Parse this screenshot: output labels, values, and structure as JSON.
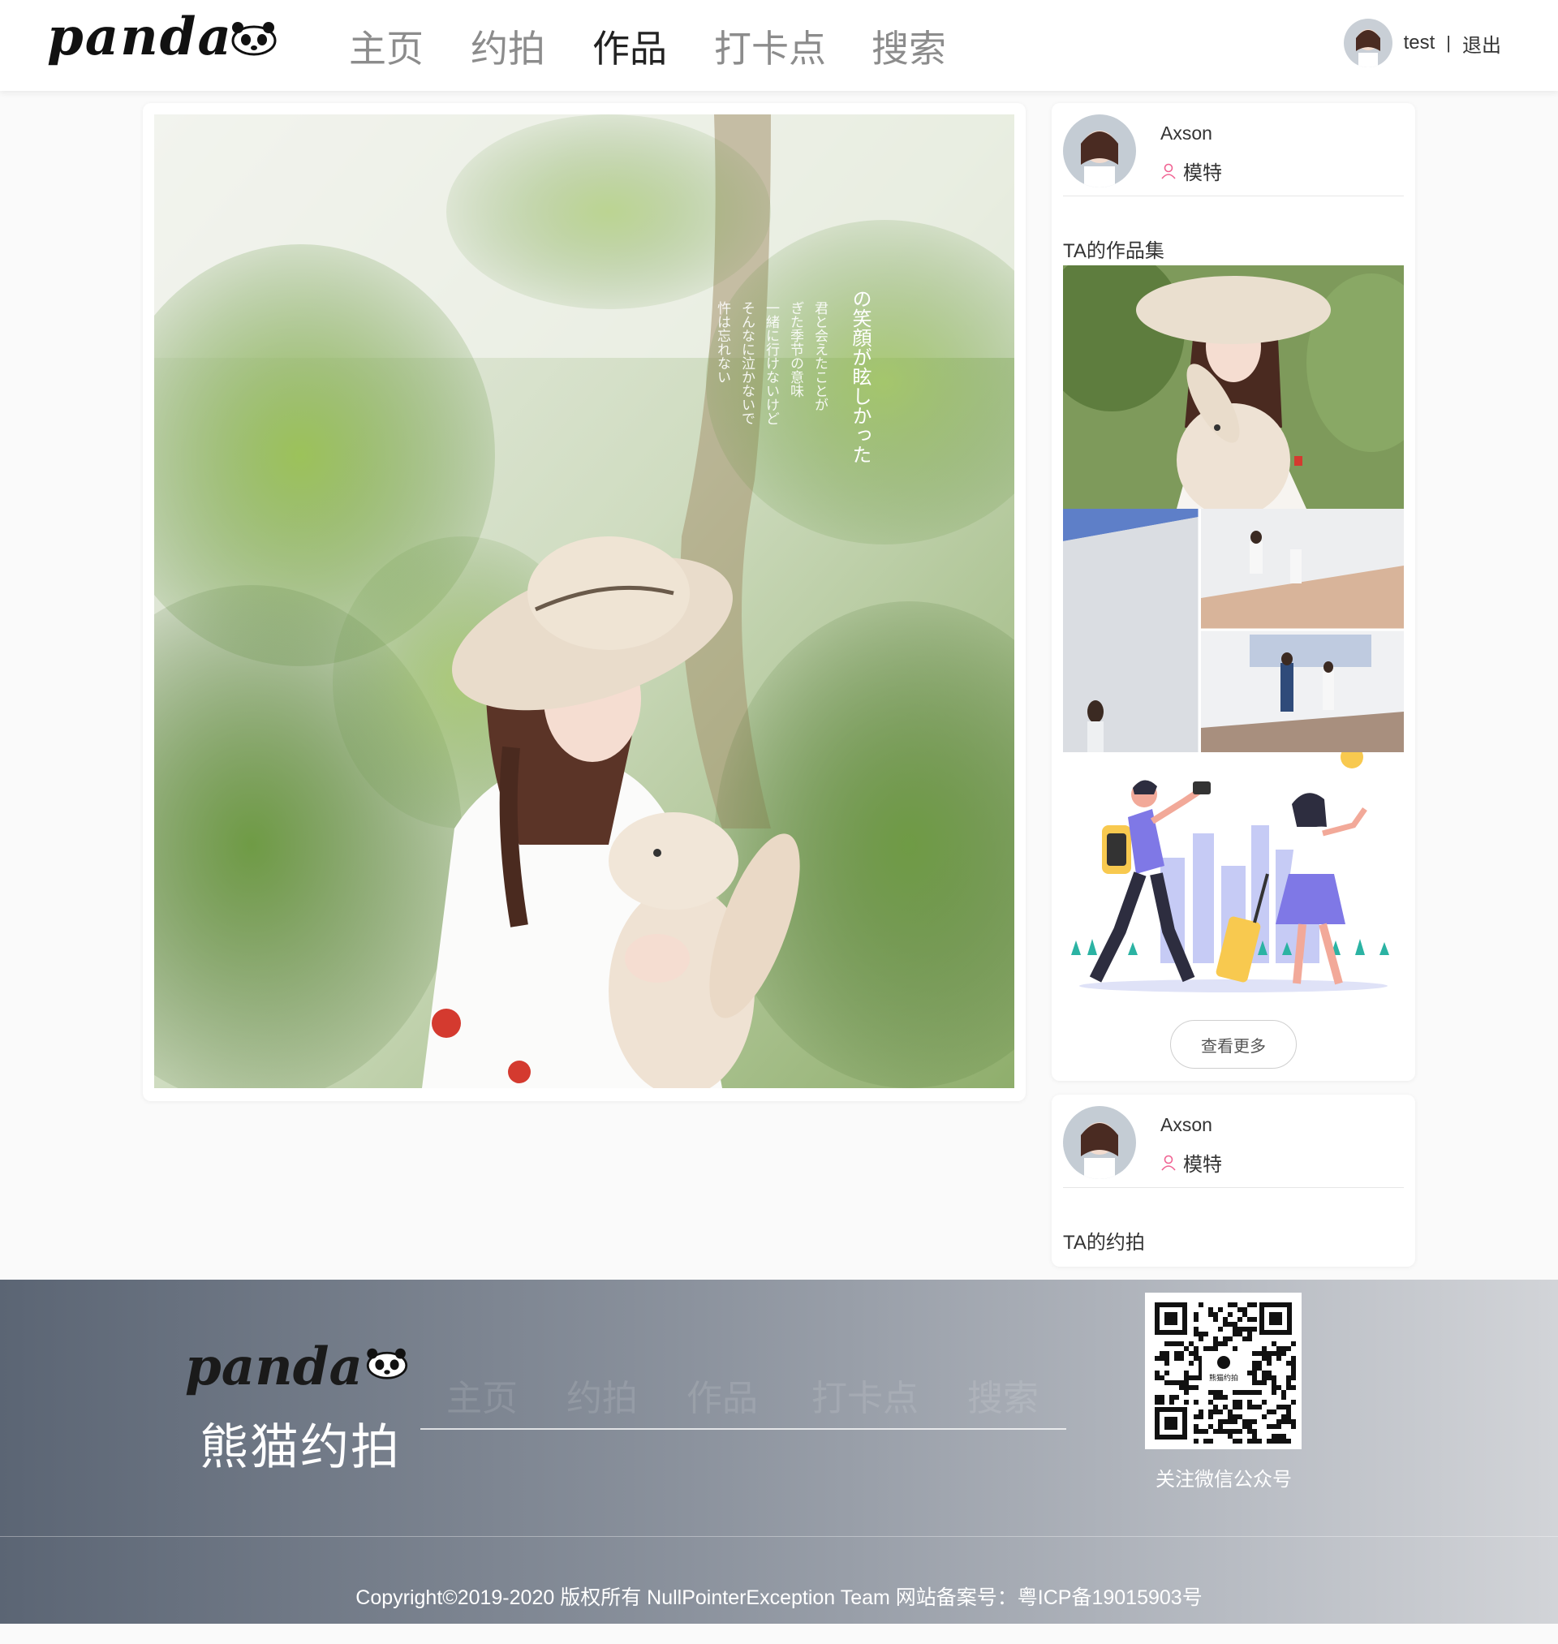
{
  "header": {
    "logo_text": "panda",
    "nav": [
      {
        "label": "主页",
        "active": false
      },
      {
        "label": "约拍",
        "active": false
      },
      {
        "label": "作品",
        "active": true
      },
      {
        "label": "打卡点",
        "active": false
      },
      {
        "label": "搜索",
        "active": false
      }
    ],
    "user": {
      "name": "test",
      "separator": "|",
      "logout": "退出"
    }
  },
  "main": {
    "photo_caption_lines": [
      "君と会えたことが",
      "ぎた季节の意味",
      "一緒に行けないけど",
      "そんなに泣かないで",
      "忤は忘れない"
    ],
    "photo_title": "の笑顔が眩しかった"
  },
  "sidebar": {
    "card1": {
      "author_name": "Axson",
      "author_role": "模特",
      "section_title": "TA的作品集",
      "more_button": "查看更多"
    },
    "card2": {
      "author_name": "Axson",
      "author_role": "模特",
      "section_title": "TA的约拍"
    }
  },
  "footer": {
    "logo_text": "panda",
    "brand": "熊猫约拍",
    "nav": [
      "主页",
      "约拍",
      "作品",
      "打卡点",
      "搜索"
    ],
    "qr_center_text": "熊猫约拍",
    "qr_label": "关注微信公众号",
    "copyright": "Copyright©2019-2020 版权所有 NullPointerException Team 网站备案号：粤ICP备19015903号"
  },
  "colors": {
    "accent_pink": "#f06292",
    "active_nav": "#222222",
    "inactive_nav": "#8c8c8c"
  }
}
